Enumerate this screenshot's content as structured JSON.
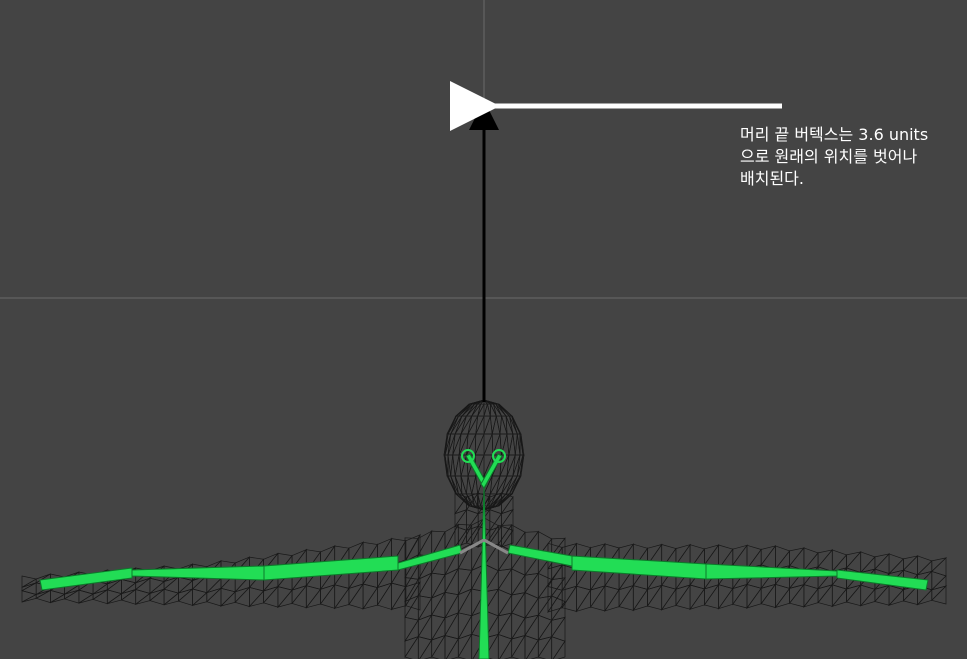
{
  "viewport": {
    "background": "#444444",
    "grid_color": "#6a6a6a",
    "mesh_color": "#111111",
    "bone_color": "#22dd55",
    "bone_outline": "#0c7a2a"
  },
  "annotation": {
    "lines": [
      "머리 끝 버텍스는 3.6 units",
      "으로 원래의 위치를 벗어나",
      "배치된다."
    ],
    "text_color": "#ffffff"
  },
  "arrows": {
    "horizontal_color": "#ffffff",
    "vertical_color": "#000000"
  }
}
